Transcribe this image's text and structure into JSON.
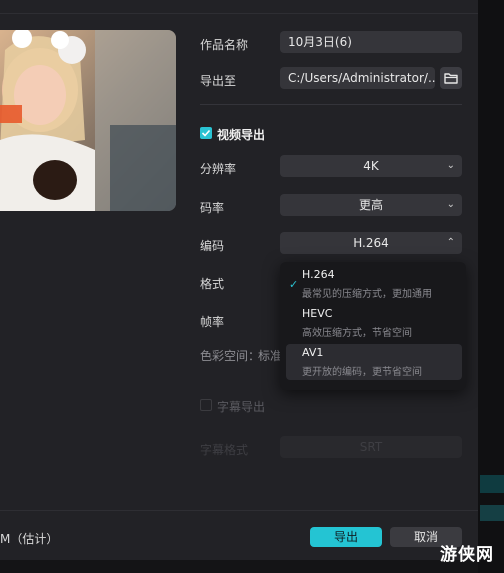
{
  "form": {
    "name_label": "作品名称",
    "name_value": "10月3日(6)",
    "export_to_label": "导出至",
    "export_path": "C:/Users/Administrator/...",
    "video_export_label": "视频导出",
    "resolution_label": "分辨率",
    "resolution_value": "4K",
    "bitrate_label": "码率",
    "bitrate_value": "更高",
    "codec_label": "编码",
    "codec_value": "H.264",
    "format_label": "格式",
    "framerate_label": "帧率",
    "colorspace_label": "色彩空间：",
    "colorspace_value": "标准",
    "subtitle_export_label": "字幕导出",
    "subtitle_format_label": "字幕格式",
    "subtitle_format_value": "SRT"
  },
  "codec_dropdown": {
    "options": [
      {
        "title": "H.264",
        "desc": "最常见的压缩方式，更加通用",
        "selected": true
      },
      {
        "title": "HEVC",
        "desc": "高效压缩方式，节省空间",
        "selected": false
      },
      {
        "title": "AV1",
        "desc": "更开放的编码，更节省空间",
        "selected": false
      }
    ]
  },
  "footer": {
    "size_text": "M（估计）",
    "export_button": "导出",
    "cancel_button": "取消"
  },
  "watermark": "游侠网",
  "colors": {
    "accent": "#2ac3d3",
    "background": "#222226",
    "field": "#35353a"
  }
}
